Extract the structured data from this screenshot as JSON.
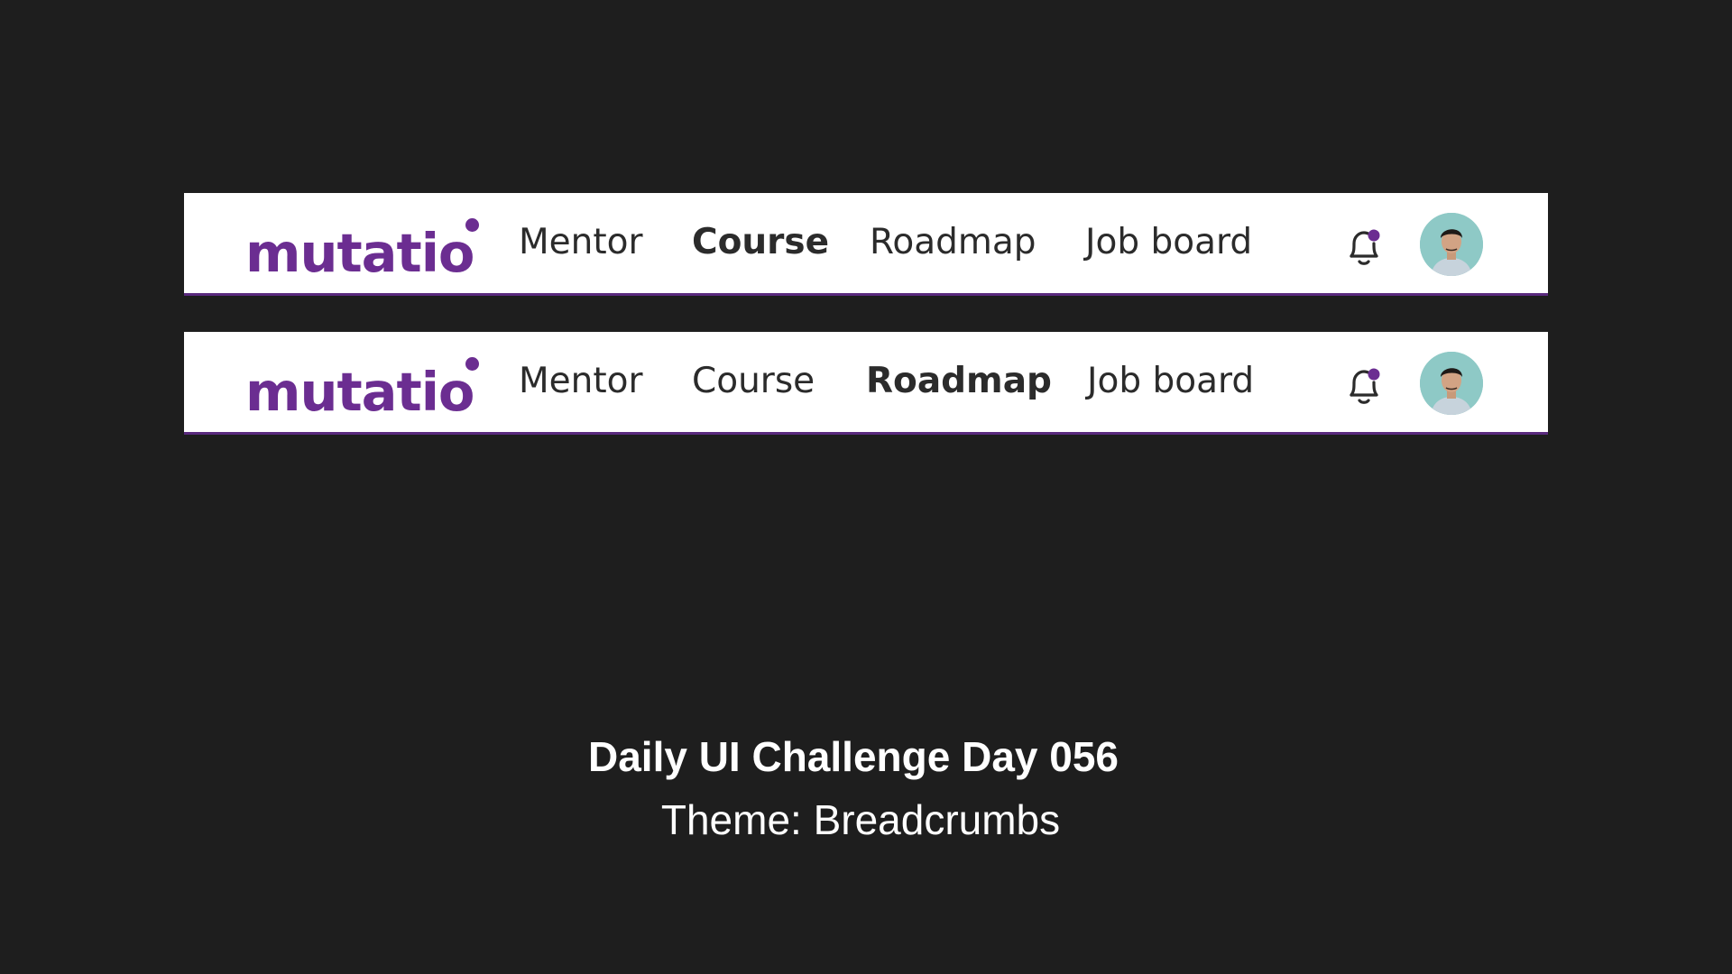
{
  "colors": {
    "brand": "#6b2d91",
    "background": "#1e1e1e",
    "navbar_bg": "#ffffff",
    "text": "#2b2b2b",
    "underline": "#5a2a7e"
  },
  "navbars": [
    {
      "logo": "mutatio",
      "items": [
        {
          "label": "Mentor",
          "active": false
        },
        {
          "label": "Course",
          "active": true
        },
        {
          "label": "Roadmap",
          "active": false
        },
        {
          "label": "Job board",
          "active": false
        }
      ],
      "notification_icon": "bell-icon",
      "has_notification": true,
      "avatar_icon": "user-avatar"
    },
    {
      "logo": "mutatio",
      "items": [
        {
          "label": "Mentor",
          "active": false
        },
        {
          "label": "Course",
          "active": false
        },
        {
          "label": "Roadmap",
          "active": true
        },
        {
          "label": "Job board",
          "active": false
        }
      ],
      "notification_icon": "bell-icon",
      "has_notification": true,
      "avatar_icon": "user-avatar"
    }
  ],
  "caption": {
    "title": "Daily UI Challenge Day 056",
    "theme": "Theme: Breadcrumbs"
  }
}
